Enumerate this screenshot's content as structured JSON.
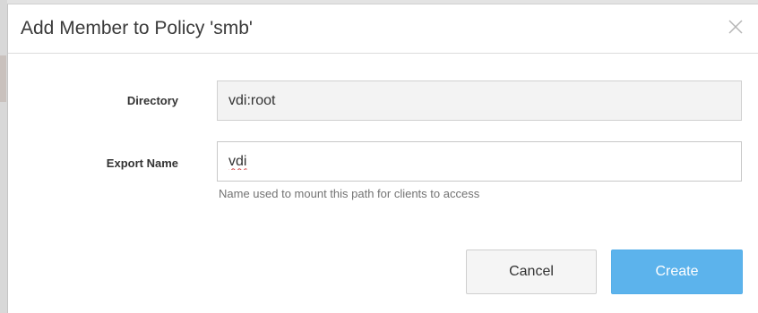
{
  "dialog": {
    "title": "Add Member to Policy 'smb'",
    "close_icon": "close-icon"
  },
  "form": {
    "directory": {
      "label": "Directory",
      "value": "vdi:root"
    },
    "export_name": {
      "label": "Export Name",
      "value": "vdi",
      "help_text": "Name used to mount this path for clients to access"
    }
  },
  "actions": {
    "cancel_label": "Cancel",
    "create_label": "Create"
  },
  "colors": {
    "primary_button": "#5cb3ec",
    "readonly_field_bg": "#f3f3f3",
    "help_text": "#737373"
  }
}
